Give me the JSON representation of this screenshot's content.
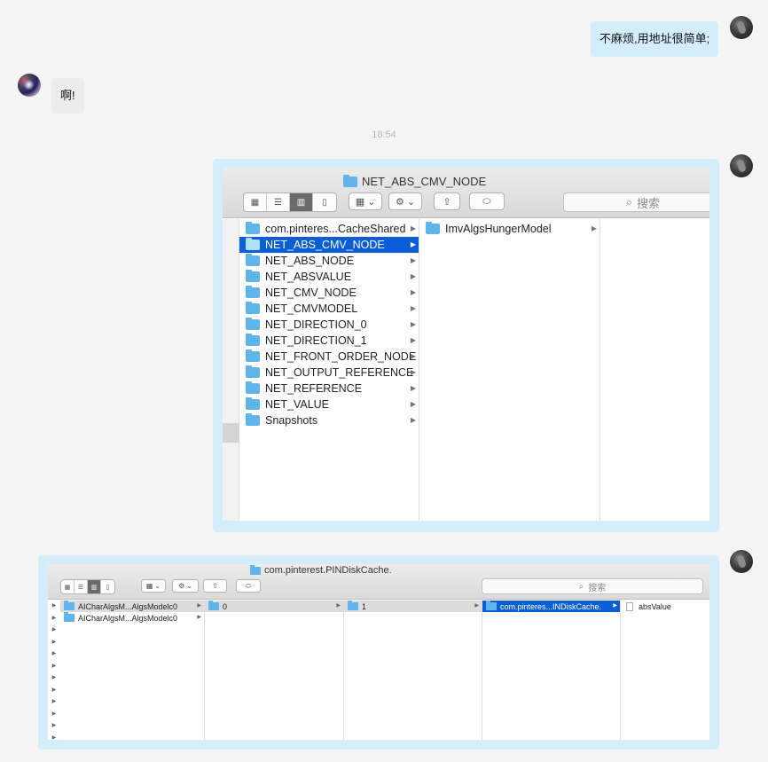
{
  "messages": {
    "msg1": "不麻烦,用地址很简单;",
    "msg2": "啊!",
    "timestamp": "18:54"
  },
  "finder1": {
    "title": "NET_ABS_CMV_NODE",
    "search_placeholder": "搜索",
    "column1": [
      "com.pinteres...CacheShared",
      "NET_ABS_CMV_NODE",
      "NET_ABS_NODE",
      "NET_ABSVALUE",
      "NET_CMV_NODE",
      "NET_CMVMODEL",
      "NET_DIRECTION_0",
      "NET_DIRECTION_1",
      "NET_FRONT_ORDER_NODE",
      "NET_OUTPUT_REFERENCE",
      "NET_REFERENCE",
      "NET_VALUE",
      "Snapshots"
    ],
    "column1_selected_index": 1,
    "column2": [
      "ImvAlgsHungerModel"
    ]
  },
  "finder2": {
    "title": "com.pinterest.PINDiskCache.",
    "search_placeholder": "搜索",
    "column1": [
      "AICharAlgsM...AlgsModelc0",
      "AICharAlgsM...AlgsModelc0"
    ],
    "column2": [
      "0"
    ],
    "column3": [
      "1"
    ],
    "column4": [
      "com.pinteres...INDiskCache."
    ],
    "column5": [
      "absValue"
    ]
  },
  "icons": {
    "arrow": "▶",
    "gear": "⚙",
    "chevron": "⌄",
    "search": "⌕"
  },
  "colors": {
    "bubble_me": "#d3edfa",
    "bubble_other": "#ececec",
    "selection": "#0b5ed8",
    "folder": "#5fb4ea"
  }
}
